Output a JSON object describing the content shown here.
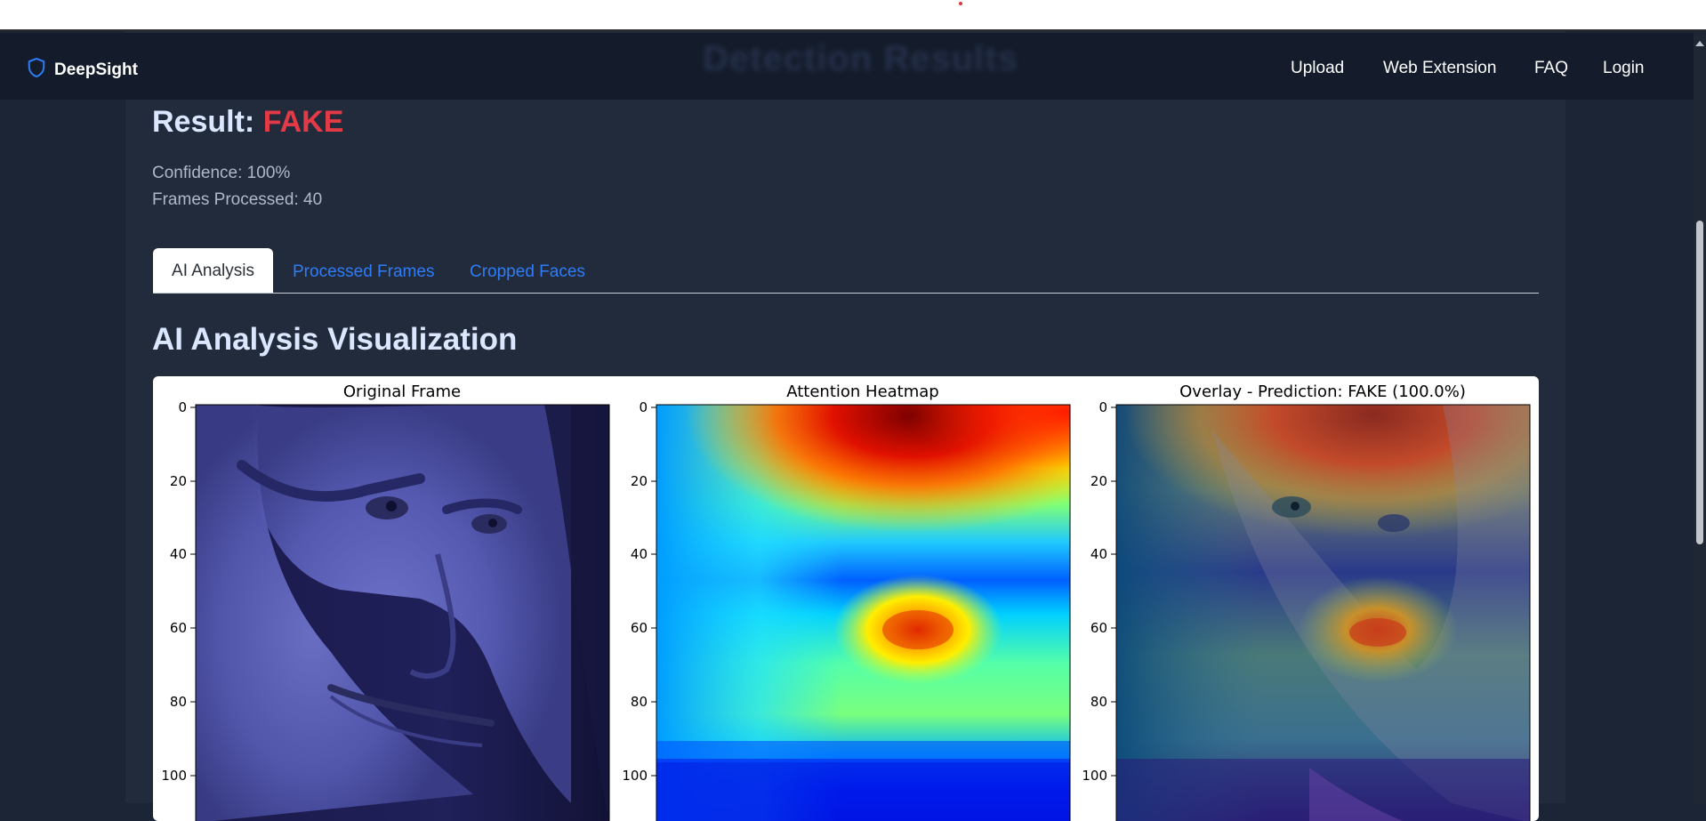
{
  "header": {
    "brand": "DeepSight",
    "brand_icon": "shield-icon",
    "background_title": "Detection Results",
    "nav": [
      {
        "label": "Upload"
      },
      {
        "label": "Web Extension"
      },
      {
        "label": "FAQ"
      },
      {
        "label": "Login"
      }
    ]
  },
  "result": {
    "label": "Result: ",
    "value": "FAKE",
    "value_color": "#e23b47",
    "confidence": "Confidence: 100%",
    "frames": "Frames Processed: 40"
  },
  "tabs": [
    {
      "label": "AI Analysis",
      "active": true
    },
    {
      "label": "Processed Frames",
      "active": false
    },
    {
      "label": "Cropped Faces",
      "active": false
    }
  ],
  "section_title": "AI Analysis Visualization",
  "figure": {
    "panels": [
      {
        "title": "Original Frame",
        "content": "face image (blue tint)"
      },
      {
        "title": "Attention Heatmap",
        "content": "jet colormap heatmap"
      },
      {
        "title": "Overlay - Prediction: FAKE (100.0%)",
        "content": "heatmap overlay on face"
      }
    ],
    "y_ticks": [
      "0",
      "20",
      "40",
      "60",
      "80",
      "100"
    ]
  }
}
